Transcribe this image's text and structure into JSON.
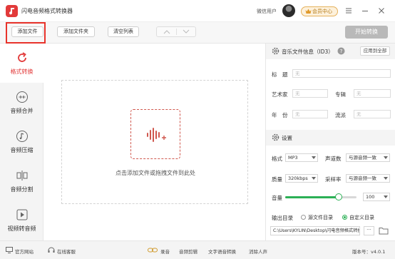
{
  "app": {
    "title": "闪电音频格式转换器",
    "user_name": "微信用户",
    "member_label": "会员中心"
  },
  "toolbar": {
    "add_file": "添加文件",
    "add_folder": "添加文件夹",
    "clear_list": "清空列表",
    "start_convert": "开始转换"
  },
  "sidebar": {
    "items": [
      {
        "label": "格式转换",
        "icon": "refresh-icon",
        "active": true
      },
      {
        "label": "音频合并",
        "icon": "merge-icon",
        "active": false
      },
      {
        "label": "音频压缩",
        "icon": "music-note-icon",
        "active": false
      },
      {
        "label": "音频分割",
        "icon": "split-icon",
        "active": false
      },
      {
        "label": "视频转音频",
        "icon": "video-play-icon",
        "active": false
      }
    ]
  },
  "main": {
    "drop_hint": "点击添加文件或拖拽文件到此处"
  },
  "id3": {
    "title": "音乐文件信息（ID3）",
    "apply_all": "应用到全部",
    "title_label": "标　题",
    "artist_label": "艺术家",
    "album_label": "专辑",
    "year_label": "年　份",
    "genre_label": "流派",
    "placeholder": "无"
  },
  "settings": {
    "title": "设置",
    "format_label": "格式",
    "format_value": "MP3",
    "channels_label": "声道数",
    "channels_value": "与源音频一致",
    "quality_label": "质量",
    "quality_value": "320kbps",
    "samplerate_label": "采样率",
    "samplerate_value": "与源音频一致",
    "volume_label": "音量",
    "volume_value": "100",
    "volume_level": 0.75,
    "output_label": "输出目录",
    "source_dir_label": "源文件目录",
    "custom_dir_label": "自定义目录",
    "selected_dir": "custom",
    "output_path": "C:\\Users\\KYLIN\\Desktop\\闪电音频格式转换",
    "more": "···"
  },
  "statusbar": {
    "website": "官方网站",
    "support": "在线客服",
    "recording": "录音",
    "audio_edit": "音频剪辑",
    "tts": "文字语音转换",
    "vocal_remove": "消除人声",
    "version": "版本号：v4.0.1"
  },
  "colors": {
    "brand_red": "#e23a3a",
    "accent_green": "#2bb055",
    "annotation_red": "#e8332b"
  }
}
